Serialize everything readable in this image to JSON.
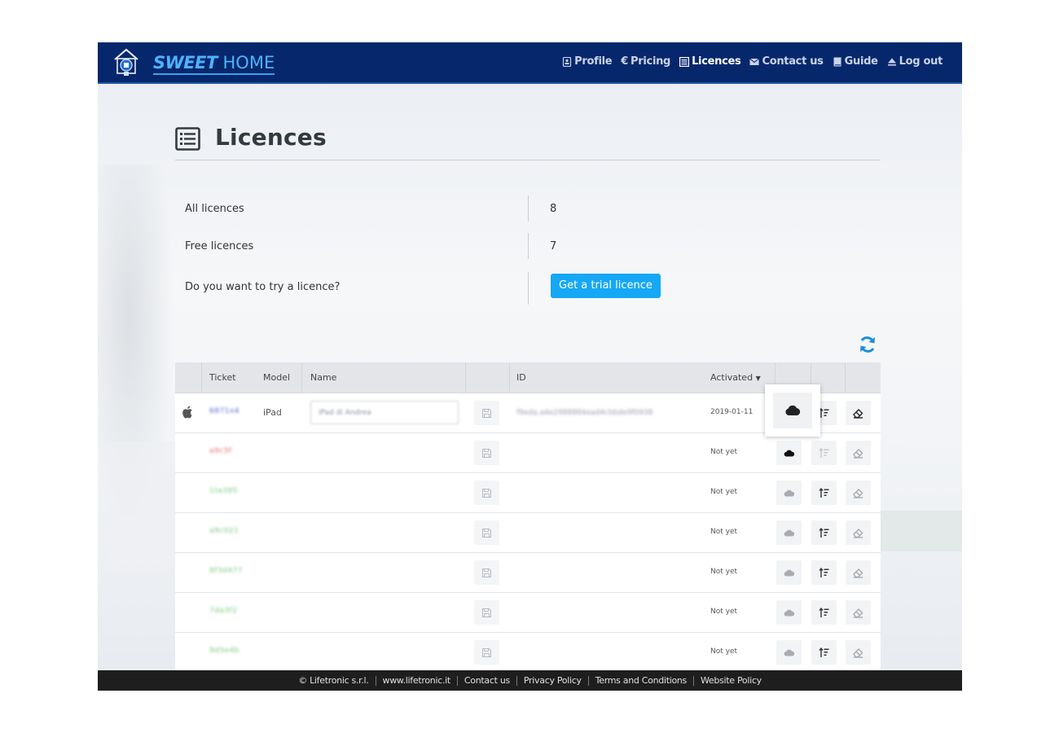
{
  "app": {
    "brand_bold": "SWEET",
    "brand_light": "HOME"
  },
  "nav": {
    "items": [
      {
        "label": "Profile",
        "icon": "profile-icon",
        "active": false
      },
      {
        "label": "Pricing",
        "icon": "euro-icon",
        "active": false
      },
      {
        "label": "Licences",
        "icon": "list-icon",
        "active": true
      },
      {
        "label": "Contact us",
        "icon": "mail-icon",
        "active": false
      },
      {
        "label": "Guide",
        "icon": "book-icon",
        "active": false
      },
      {
        "label": "Log out",
        "icon": "eject-icon",
        "active": false
      }
    ]
  },
  "page": {
    "title": "Licences",
    "icon": "list-icon"
  },
  "info": {
    "all_label": "All licences",
    "all_value": "8",
    "free_label": "Free licences",
    "free_value": "7",
    "trial_label": "Do you want to try a licence?",
    "trial_button": "Get a trial licence"
  },
  "table": {
    "headers": {
      "ticket": "Ticket",
      "model": "Model",
      "name": "Name",
      "id": "ID",
      "activated": "Activated"
    },
    "rows": [
      {
        "ticket": "6871x4",
        "ticket_color": "#4a64c8",
        "model": "iPad",
        "name": "iPad di Andrea",
        "id": "f9eda.a4e2988884ead4cbbde9f0938",
        "activated": "2019-01-11",
        "has_device": true
      },
      {
        "ticket": "a9c5f",
        "ticket_color": "#e06a6a",
        "model": "",
        "name": "",
        "id": "",
        "activated": "Not yet",
        "has_device": false
      },
      {
        "ticket": "1ta385",
        "ticket_color": "#7cc47c",
        "model": "",
        "name": "",
        "id": "",
        "activated": "Not yet",
        "has_device": false
      },
      {
        "ticket": "a9c021",
        "ticket_color": "#7cc47c",
        "model": "",
        "name": "",
        "id": "",
        "activated": "Not yet",
        "has_device": false
      },
      {
        "ticket": "8f3d477",
        "ticket_color": "#7cc47c",
        "model": "",
        "name": "",
        "id": "",
        "activated": "Not yet",
        "has_device": false
      },
      {
        "ticket": "7da3f2",
        "ticket_color": "#7cc47c",
        "model": "",
        "name": "",
        "id": "",
        "activated": "Not yet",
        "has_device": false
      },
      {
        "ticket": "9d5e4b",
        "ticket_color": "#7cc47c",
        "model": "",
        "name": "",
        "id": "",
        "activated": "Not yet",
        "has_device": false
      }
    ]
  },
  "footer": {
    "links": [
      "© Lifetronic s.r.l.",
      "www.lifetronic.it",
      "Contact us",
      "Privacy Policy",
      "Terms and Conditions",
      "Website Policy"
    ]
  }
}
